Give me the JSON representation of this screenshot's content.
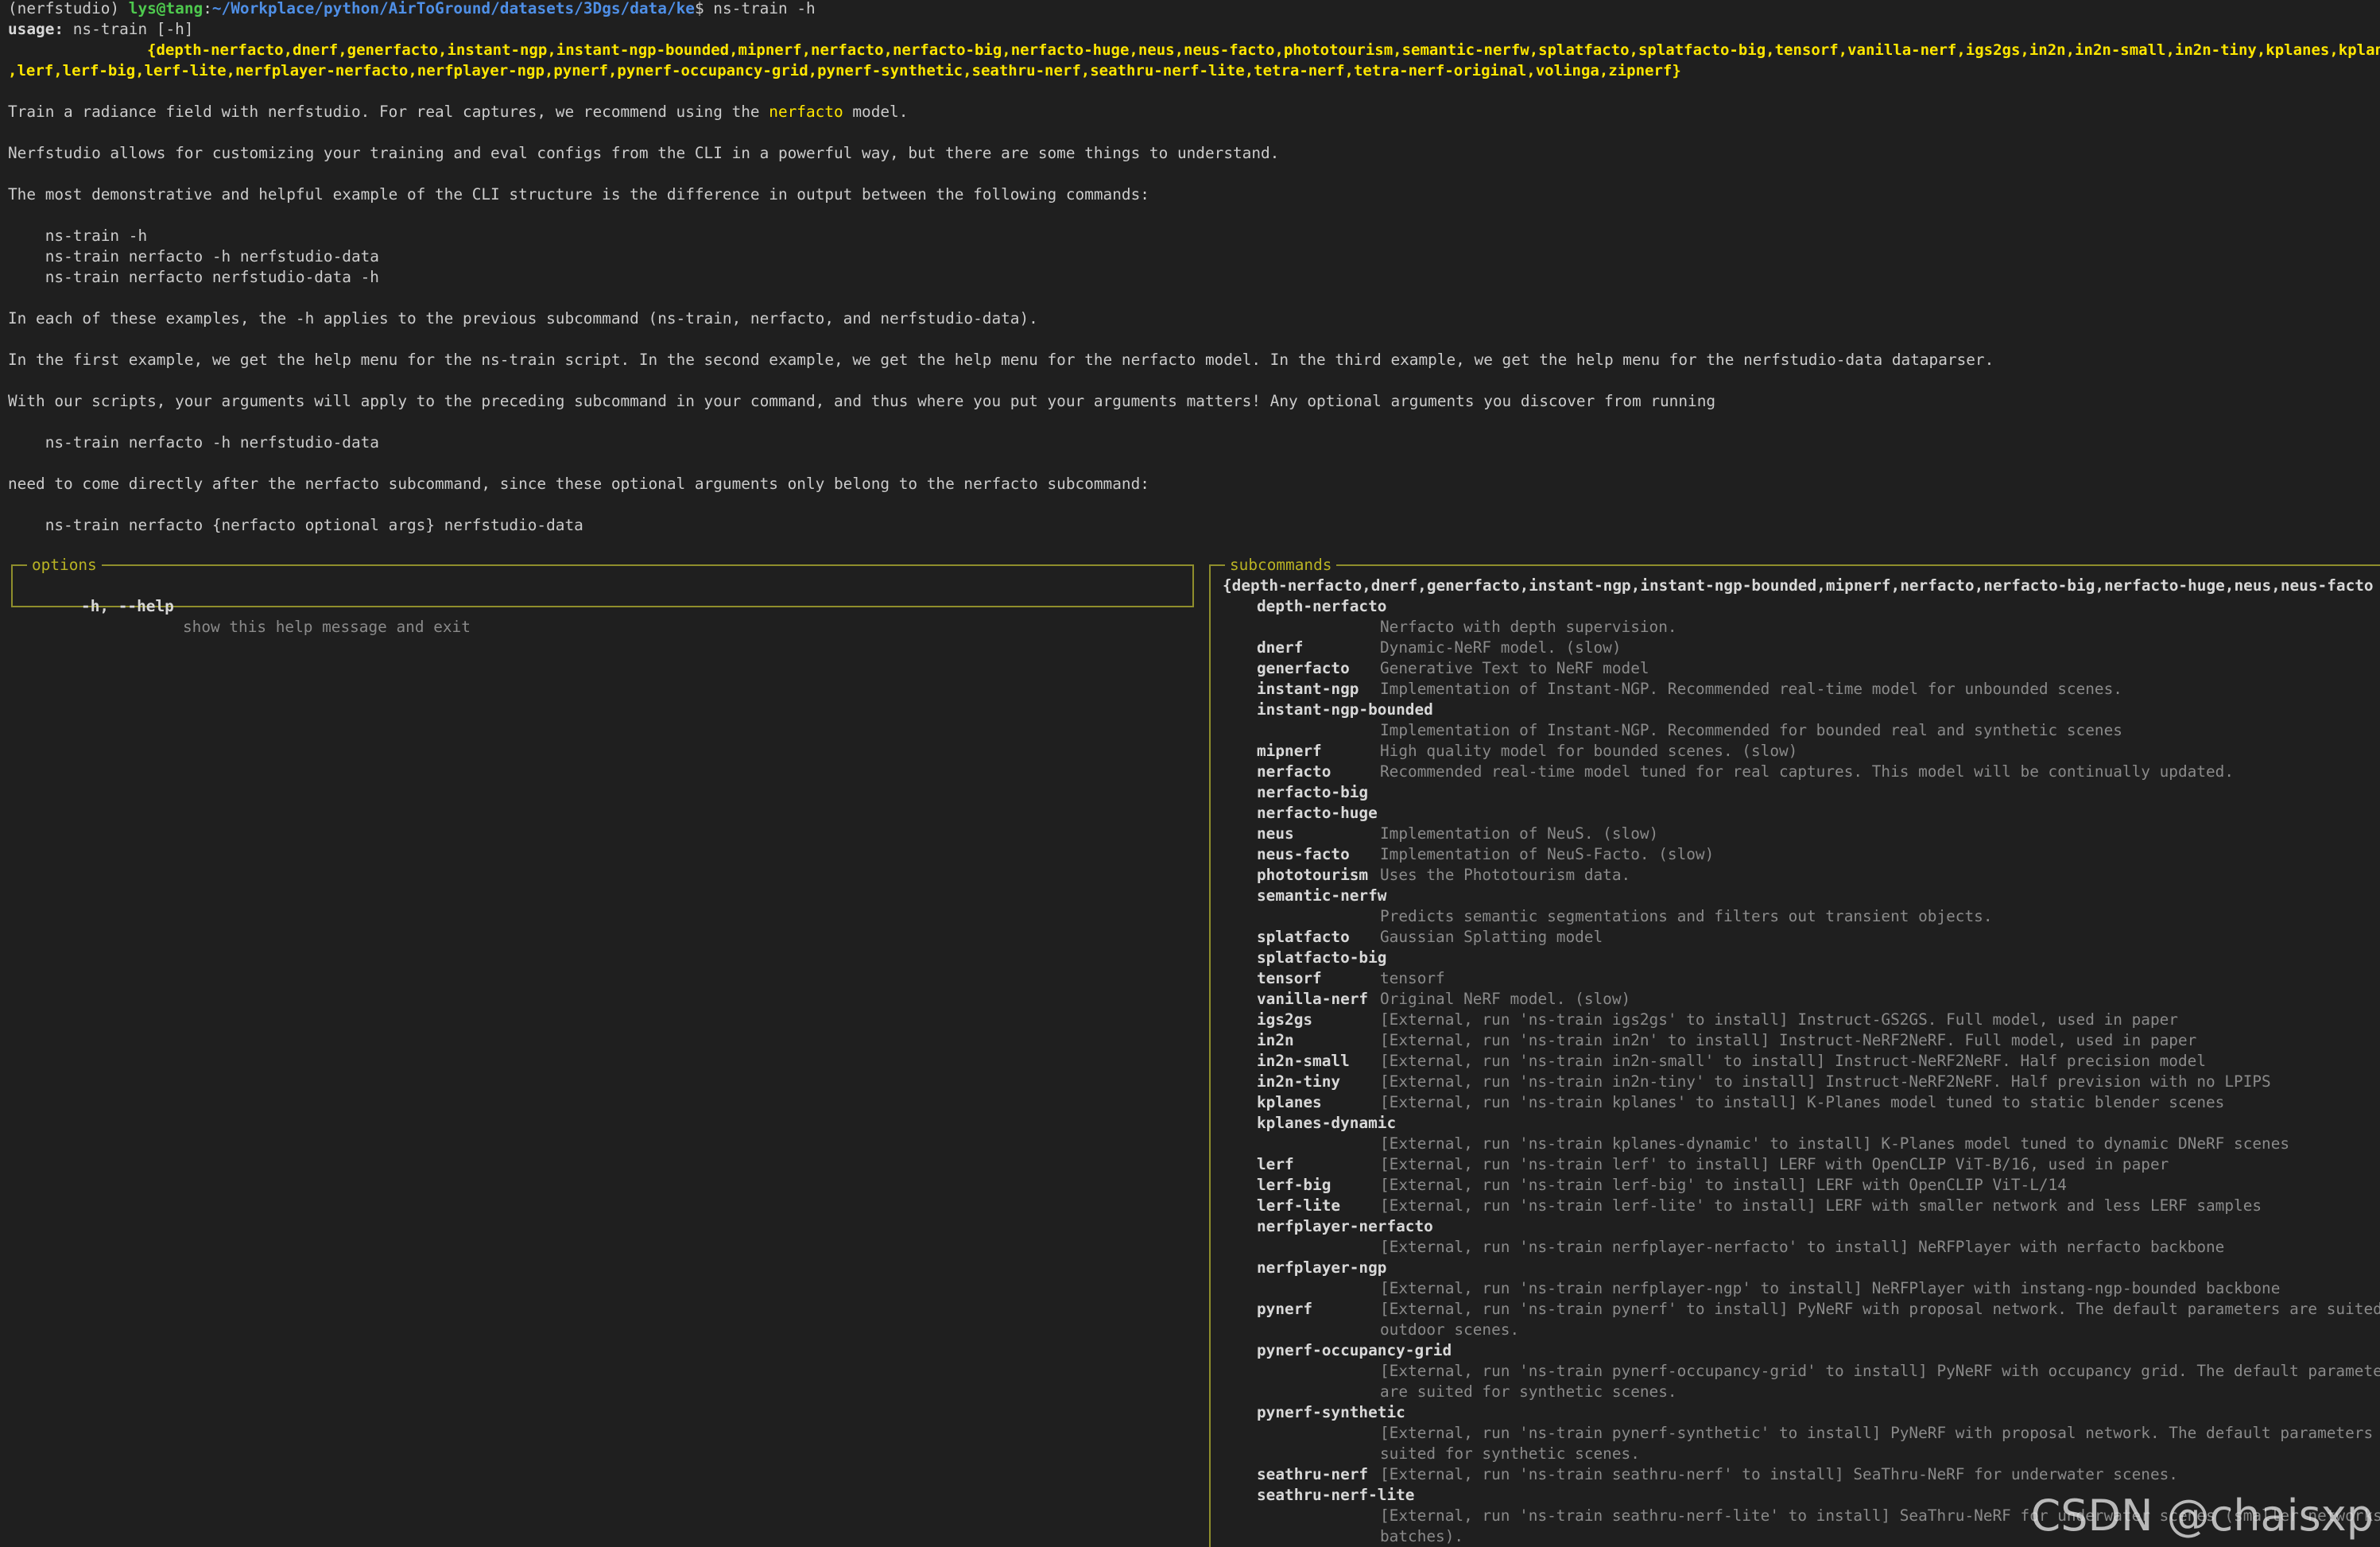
{
  "prompt": {
    "env": "(nerfstudio)",
    "user_host": "lys@tang",
    "path_sep": ":",
    "path": "~/Workplace/python/AirToGround/datasets/3Dgs/data/ke",
    "symbol": "$",
    "command": " ns-train -h"
  },
  "usage": {
    "label": "usage:",
    "text": " ns-train [-h]",
    "choices_line1": "{depth-nerfacto,dnerf,generfacto,instant-ngp,instant-ngp-bounded,mipnerf,nerfacto,nerfacto-big,nerfacto-huge,neus,neus-facto,phototourism,semantic-nerfw,splatfacto,splatfacto-big,tensorf,vanilla-nerf,igs2gs,in2n,in2n-small,in2n-tiny,kplanes,kplanes-dynamic",
    "choices_line2": ",lerf,lerf-big,lerf-lite,nerfplayer-nerfacto,nerfplayer-ngp,pynerf,pynerf-occupancy-grid,pynerf-synthetic,seathru-nerf,seathru-nerf-lite,tetra-nerf,tetra-nerf-original,volinga,zipnerf}"
  },
  "description": {
    "p1_a": "Train a radiance field with nerfstudio. For real captures, we recommend using the ",
    "p1_hl": "nerfacto",
    "p1_b": " model.",
    "p2": "Nerfstudio allows for customizing your training and eval configs from the CLI in a powerful way, but there are some things to understand.",
    "p3": "The most demonstrative and helpful example of the CLI structure is the difference in output between the following commands:",
    "ex1": "    ns-train -h",
    "ex2": "    ns-train nerfacto -h nerfstudio-data",
    "ex3": "    ns-train nerfacto nerfstudio-data -h",
    "p4": "In each of these examples, the -h applies to the previous subcommand (ns-train, nerfacto, and nerfstudio-data).",
    "p5": "In the first example, we get the help menu for the ns-train script. In the second example, we get the help menu for the nerfacto model. In the third example, we get the help menu for the nerfstudio-data dataparser.",
    "p6": "With our scripts, your arguments will apply to the preceding subcommand in your command, and thus where you put your arguments matters! Any optional arguments you discover from running",
    "ex4": "    ns-train nerfacto -h nerfstudio-data",
    "p7": "need to come directly after the nerfacto subcommand, since these optional arguments only belong to the nerfacto subcommand:",
    "ex5": "    ns-train nerfacto {nerfacto optional args} nerfstudio-data"
  },
  "options": {
    "title": "options",
    "flag": "-h, --help",
    "desc": "show this help message and exit"
  },
  "subcommands": {
    "title": "subcommands",
    "choices": "{depth-nerfacto,dnerf,generfacto,instant-ngp,instant-ngp-bounded,mipnerf,nerfacto,nerfacto-big,nerfacto-huge,neus,neus-facto,photo…",
    "lines": [
      {
        "name": "depth-nerfacto",
        "desc": ""
      },
      {
        "name": "",
        "desc": "Nerfacto with depth supervision."
      },
      {
        "name": "dnerf",
        "desc": "Dynamic-NeRF model. (slow)"
      },
      {
        "name": "generfacto",
        "desc": "Generative Text to NeRF model"
      },
      {
        "name": "instant-ngp",
        "desc": "Implementation of Instant-NGP. Recommended real-time model for unbounded scenes."
      },
      {
        "name": "instant-ngp-bounded",
        "desc": ""
      },
      {
        "name": "",
        "desc": "Implementation of Instant-NGP. Recommended for bounded real and synthetic scenes"
      },
      {
        "name": "mipnerf",
        "desc": "High quality model for bounded scenes. (slow)"
      },
      {
        "name": "nerfacto",
        "desc": "Recommended real-time model tuned for real captures. This model will be continually updated."
      },
      {
        "name": "nerfacto-big",
        "desc": ""
      },
      {
        "name": "nerfacto-huge",
        "desc": ""
      },
      {
        "name": "neus",
        "desc": "Implementation of NeuS. (slow)"
      },
      {
        "name": "neus-facto",
        "desc": "Implementation of NeuS-Facto. (slow)"
      },
      {
        "name": "phototourism",
        "desc": "Uses the Phototourism data."
      },
      {
        "name": "semantic-nerfw",
        "desc": ""
      },
      {
        "name": "",
        "desc": "Predicts semantic segmentations and filters out transient objects."
      },
      {
        "name": "splatfacto",
        "desc": "Gaussian Splatting model"
      },
      {
        "name": "splatfacto-big",
        "desc": ""
      },
      {
        "name": "tensorf",
        "desc": "tensorf"
      },
      {
        "name": "vanilla-nerf",
        "desc": "Original NeRF model. (slow)"
      },
      {
        "name": "igs2gs",
        "desc": "[External, run 'ns-train igs2gs' to install] Instruct-GS2GS. Full model, used in paper"
      },
      {
        "name": "in2n",
        "desc": "[External, run 'ns-train in2n' to install] Instruct-NeRF2NeRF. Full model, used in paper"
      },
      {
        "name": "in2n-small",
        "desc": "[External, run 'ns-train in2n-small' to install] Instruct-NeRF2NeRF. Half precision model"
      },
      {
        "name": "in2n-tiny",
        "desc": "[External, run 'ns-train in2n-tiny' to install] Instruct-NeRF2NeRF. Half prevision with no LPIPS"
      },
      {
        "name": "kplanes",
        "desc": "[External, run 'ns-train kplanes' to install] K-Planes model tuned to static blender scenes"
      },
      {
        "name": "kplanes-dynamic",
        "desc": ""
      },
      {
        "name": "",
        "desc": "[External, run 'ns-train kplanes-dynamic' to install] K-Planes model tuned to dynamic DNeRF scenes"
      },
      {
        "name": "lerf",
        "desc": "[External, run 'ns-train lerf' to install] LERF with OpenCLIP ViT-B/16, used in paper"
      },
      {
        "name": "lerf-big",
        "desc": "[External, run 'ns-train lerf-big' to install] LERF with OpenCLIP ViT-L/14"
      },
      {
        "name": "lerf-lite",
        "desc": "[External, run 'ns-train lerf-lite' to install] LERF with smaller network and less LERF samples"
      },
      {
        "name": "nerfplayer-nerfacto",
        "desc": ""
      },
      {
        "name": "",
        "desc": "[External, run 'ns-train nerfplayer-nerfacto' to install] NeRFPlayer with nerfacto backbone"
      },
      {
        "name": "nerfplayer-ngp",
        "desc": ""
      },
      {
        "name": "",
        "desc": "[External, run 'ns-train nerfplayer-ngp' to install] NeRFPlayer with instang-ngp-bounded backbone"
      },
      {
        "name": "pynerf",
        "desc": "[External, run 'ns-train pynerf' to install] PyNeRF with proposal network. The default parameters are suited for"
      },
      {
        "name": "",
        "desc": "outdoor scenes."
      },
      {
        "name": "pynerf-occupancy-grid",
        "desc": ""
      },
      {
        "name": "",
        "desc": "[External, run 'ns-train pynerf-occupancy-grid' to install] PyNeRF with occupancy grid. The default parameters"
      },
      {
        "name": "",
        "desc": "are suited for synthetic scenes."
      },
      {
        "name": "pynerf-synthetic",
        "desc": ""
      },
      {
        "name": "",
        "desc": "[External, run 'ns-train pynerf-synthetic' to install] PyNeRF with proposal network. The default parameters are"
      },
      {
        "name": "",
        "desc": "suited for synthetic scenes."
      },
      {
        "name": "seathru-nerf",
        "desc": "[External, run 'ns-train seathru-nerf' to install] SeaThru-NeRF for underwater scenes."
      },
      {
        "name": "seathru-nerf-lite",
        "desc": ""
      },
      {
        "name": "",
        "desc": "[External, run 'ns-train seathru-nerf-lite' to install] SeaThru-NeRF for underwater scenes (smaller networks and"
      },
      {
        "name": "",
        "desc": "batches)."
      }
    ]
  },
  "watermark": "CSDN @chaisxp"
}
